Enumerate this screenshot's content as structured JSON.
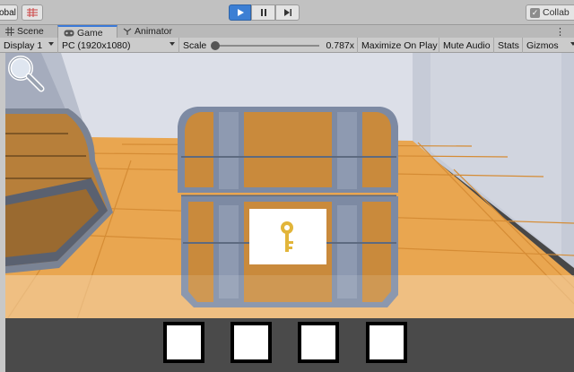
{
  "toolbar": {
    "global_label": "obal",
    "play_icon": "play-icon",
    "pause_icon": "pause-icon",
    "step_icon": "step-icon",
    "collab_label": "Collab",
    "accent": "#3c7fd4"
  },
  "tabs": [
    {
      "label": "Scene",
      "icon": "grid-icon"
    },
    {
      "label": "Game",
      "icon": "gamepad-icon",
      "active": true
    },
    {
      "label": "Animator",
      "icon": "animator-icon"
    }
  ],
  "gamebar": {
    "display": "Display 1",
    "resolution": "PC (1920x1080)",
    "scale_label": "Scale",
    "scale_value": "0.787x",
    "maximize": "Maximize On Play",
    "mute": "Mute Audio",
    "stats": "Stats",
    "gizmos": "Gizmos"
  },
  "game": {
    "scene": "treasure-chest-room",
    "chest_icon": "key-icon",
    "inventory_slots": 4,
    "hint_icon": "magnifier-icon",
    "colors": {
      "wood": "#c98a3c",
      "metal": "#7d8aa3",
      "floor": "#e9a650",
      "wall": "#d7dbe6",
      "key": "#e2b53a"
    }
  }
}
